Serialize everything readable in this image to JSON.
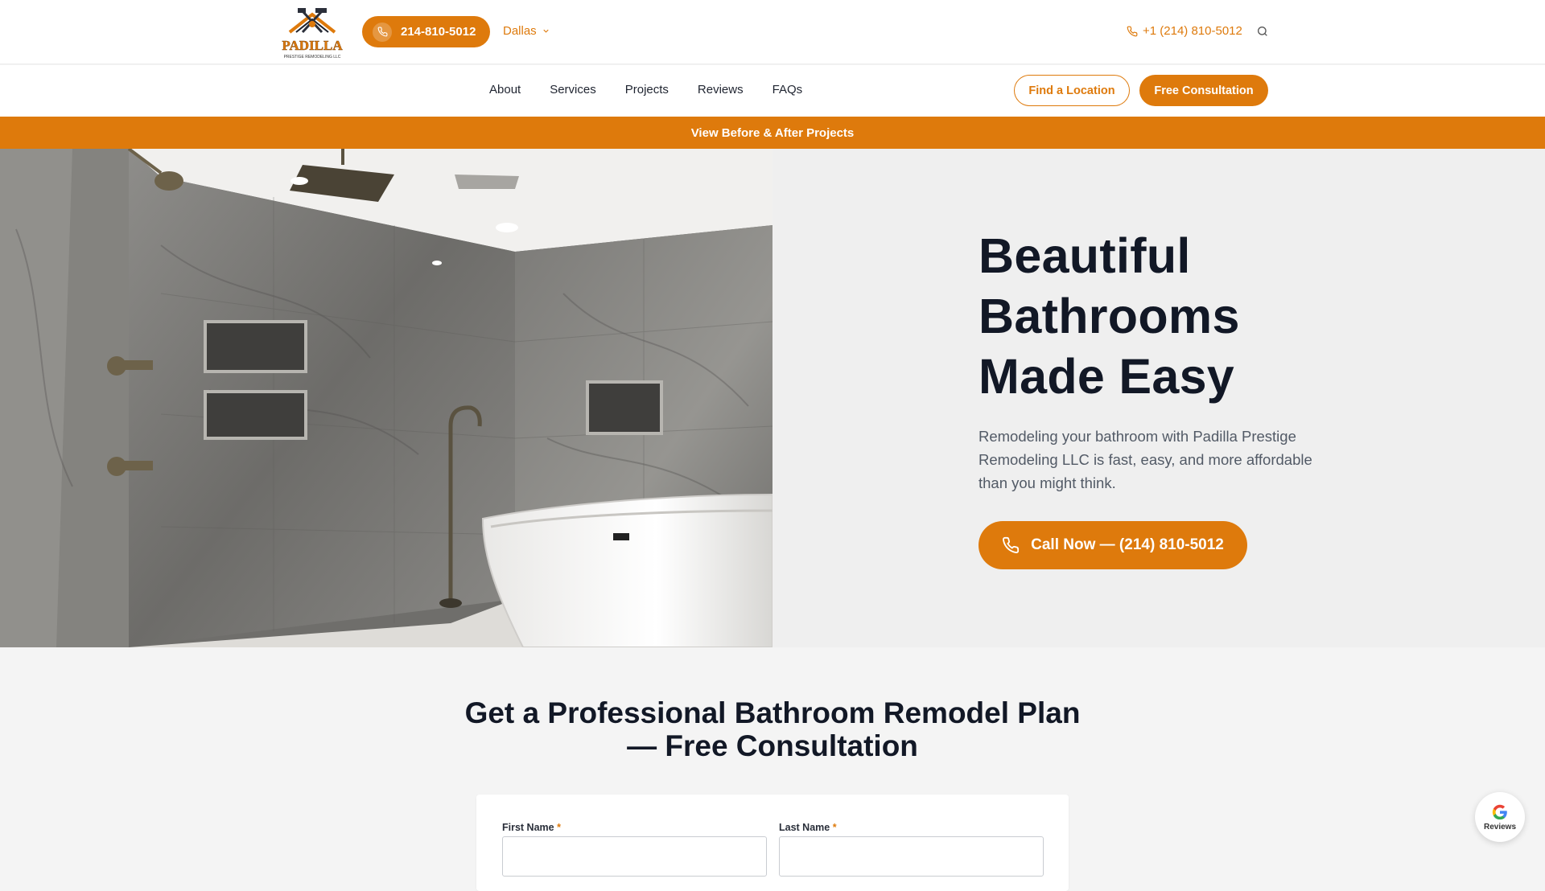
{
  "header": {
    "logo_text": "PADILLA",
    "logo_subtext": "PRESTIGE REMODELING LLC",
    "phone_button_label": "214-810-5012",
    "city": "Dallas",
    "top_phone": "+1 (214) 810-5012"
  },
  "nav": {
    "items": [
      {
        "label": "About"
      },
      {
        "label": "Services"
      },
      {
        "label": "Projects"
      },
      {
        "label": "Reviews"
      },
      {
        "label": "FAQs"
      }
    ],
    "find_location_label": "Find a Location",
    "consultation_label": "Free Consultation"
  },
  "banner": {
    "label": "View Before & After Projects"
  },
  "hero": {
    "title": "Beautiful Bathrooms Made Easy",
    "subtitle": "Remodeling your bathroom with Padilla Prestige Remodeling LLC is fast, easy, and more affordable than you might think.",
    "cta_label": "Call Now — (214) 810-5012"
  },
  "form_section": {
    "title": "Get a Professional Bathroom Remodel Plan — Free Consultation",
    "first_name_label": "First Name",
    "last_name_label": "Last Name",
    "required_marker": "*"
  },
  "reviews_badge": {
    "label": "Reviews"
  },
  "colors": {
    "accent": "#de7a0c",
    "heading": "#121826",
    "hero_bg": "#efefef"
  }
}
